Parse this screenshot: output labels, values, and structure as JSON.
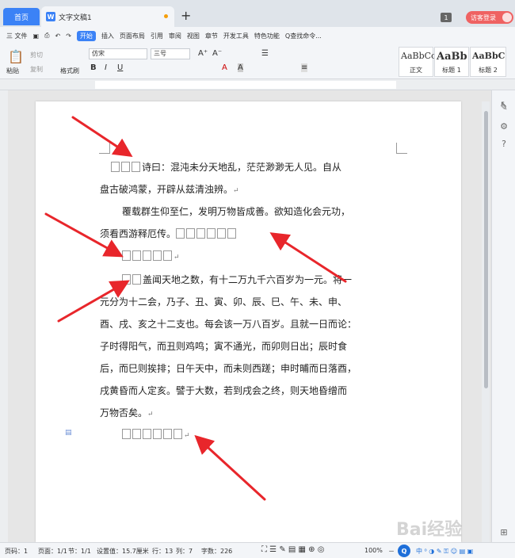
{
  "tabs": {
    "home": "首页",
    "doc": "文字文稿1",
    "new_tab": "+",
    "window_count": "1",
    "login": "访客登录"
  },
  "menu": {
    "file": "三 文件",
    "items": [
      "开始",
      "插入",
      "页面布局",
      "引用",
      "审阅",
      "视图",
      "章节",
      "开发工具",
      "特色功能"
    ],
    "search": "Q查找命令..."
  },
  "ribbon": {
    "paste": "粘贴",
    "cut": "剪切",
    "copy": "复制",
    "format_painter": "格式刷",
    "font": "仿宋",
    "size": "三号",
    "styles": [
      {
        "preview": "AaBbCc",
        "name": "正文"
      },
      {
        "preview": "AaBb",
        "name": "标题 1"
      },
      {
        "preview": "AaBbC",
        "name": "标题 2"
      }
    ]
  },
  "doc": {
    "p1a": "诗曰：混沌未分天地乱，茫茫渺渺无人见。自从",
    "p1b": "盘古破鸿蒙，开辟从兹清浊辨。",
    "p2a": "覆载群生仰至仁，发明万物皆成善。欲知造化会元功，",
    "p2b": "须看西游释厄传。",
    "p4a": "盖闻天地之数，有十二万九千六百岁为一元。将一",
    "p4b": "元分为十二会，乃子、丑、寅、卯、辰、巳、午、未、申、",
    "p4c": "酉、戌、亥之十二支也。每会该一万八百岁。且就一日而论：",
    "p4d": "子时得阳气，而丑则鸡鸣；寅不通光，而卯则日出；辰时食",
    "p4e": "后，而巳则挨排；日午天中，而未则西蹉；申时晡而日落酉，",
    "p4f": "戌黄昏而人定亥。譬于大数，若到戌会之终，则天地昏缯而",
    "p4g": "万物否矣。",
    "para_mark": "↵"
  },
  "status": {
    "page_no": "页码：1",
    "pages": "页面：1/1",
    "section": "节：1/1",
    "setting": "设置值：15.7厘米",
    "row": "行：13",
    "col": "列：7",
    "words": "字数：226",
    "zoom": "100%",
    "minus": "－"
  },
  "watermark": "Bai经验",
  "colors": {
    "accent": "#3b82f6",
    "arrow": "#e8262b",
    "login": "#ef6262"
  }
}
